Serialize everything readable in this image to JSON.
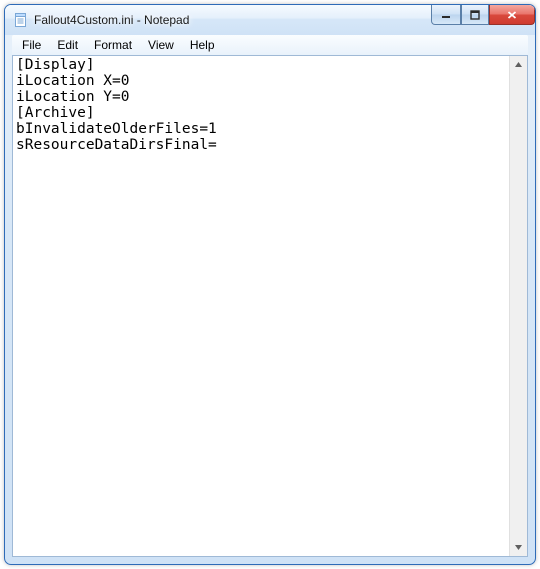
{
  "window": {
    "title": "Fallout4Custom.ini - Notepad"
  },
  "menu": {
    "file": "File",
    "edit": "Edit",
    "format": "Format",
    "view": "View",
    "help": "Help"
  },
  "editor": {
    "content": "[Display]\niLocation X=0\niLocation Y=0\n[Archive]\nbInvalidateOlderFiles=1\nsResourceDataDirsFinal=\n"
  }
}
